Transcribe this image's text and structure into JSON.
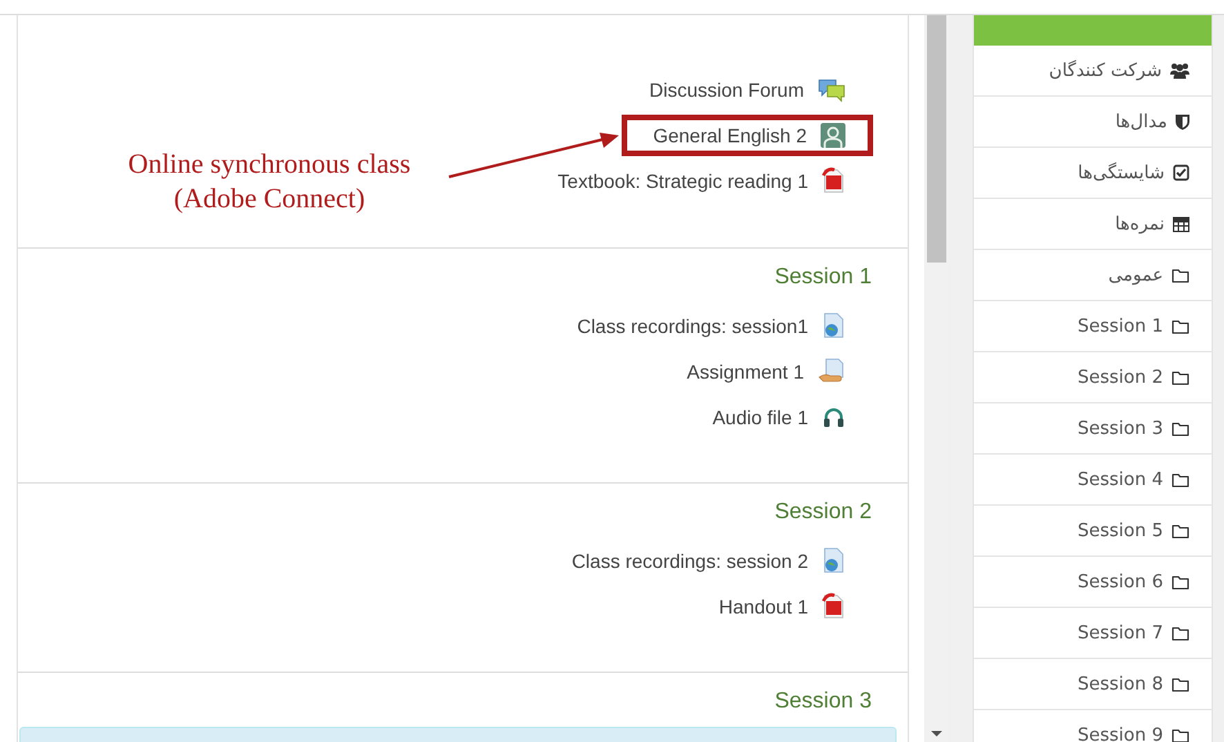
{
  "annotation": {
    "text": "Online synchronous class (Adobe Connect)"
  },
  "sections": [
    {
      "activities": [
        {
          "label": "Discussion Forum",
          "kind": "forum",
          "highlighted": false
        },
        {
          "label": "General English 2",
          "kind": "adobe",
          "highlighted": true
        },
        {
          "label": "Textbook: Strategic reading 1",
          "kind": "pdf",
          "highlighted": false
        }
      ]
    },
    {
      "title": "Session 1",
      "activities": [
        {
          "label": "Class recordings: session1",
          "kind": "url",
          "highlighted": false
        },
        {
          "label": "Assignment 1",
          "kind": "assignment",
          "highlighted": false
        },
        {
          "label": "Audio file 1",
          "kind": "audio",
          "highlighted": false
        }
      ]
    },
    {
      "title": "Session 2",
      "activities": [
        {
          "label": "Class recordings: session 2",
          "kind": "url",
          "highlighted": false
        },
        {
          "label": "Handout 1",
          "kind": "pdf",
          "highlighted": false
        }
      ]
    },
    {
      "title": "Session 3",
      "has_notice": true
    }
  ],
  "sidebar": {
    "items": [
      {
        "label": "شرکت کنندگان",
        "kind": "users"
      },
      {
        "label": "مدال‌ها",
        "kind": "shield"
      },
      {
        "label": "شایستگی‌ها",
        "kind": "check"
      },
      {
        "label": "نمره‌ها",
        "kind": "table"
      },
      {
        "label": "عمومی",
        "kind": "folder"
      },
      {
        "label": "Session 1",
        "kind": "folder"
      },
      {
        "label": "Session 2",
        "kind": "folder"
      },
      {
        "label": "Session 3",
        "kind": "folder"
      },
      {
        "label": "Session 4",
        "kind": "folder"
      },
      {
        "label": "Session 5",
        "kind": "folder"
      },
      {
        "label": "Session 6",
        "kind": "folder"
      },
      {
        "label": "Session 7",
        "kind": "folder"
      },
      {
        "label": "Session 8",
        "kind": "folder"
      },
      {
        "label": "Session 9",
        "kind": "folder"
      }
    ]
  }
}
